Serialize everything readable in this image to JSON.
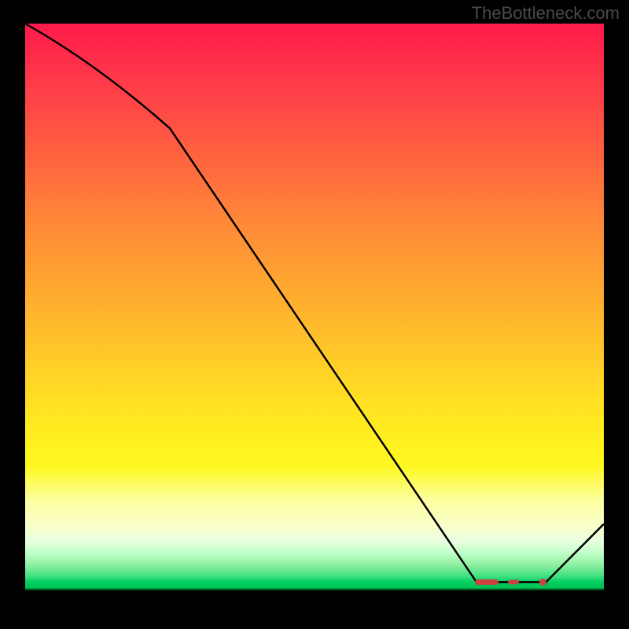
{
  "watermark": "TheBottleneck.com",
  "chart_data": {
    "type": "line",
    "title": "",
    "xlabel": "",
    "ylabel": "",
    "xlim": [
      0,
      100
    ],
    "ylim": [
      0,
      100
    ],
    "x": [
      0,
      25,
      78,
      90,
      100
    ],
    "values": [
      100,
      82,
      4,
      4,
      14
    ],
    "flat_segment": {
      "x_start": 78,
      "x_end": 90,
      "y": 4,
      "marker_color": "#d04040"
    },
    "line_color": "#000000",
    "background": "rainbow-vertical-gradient"
  }
}
